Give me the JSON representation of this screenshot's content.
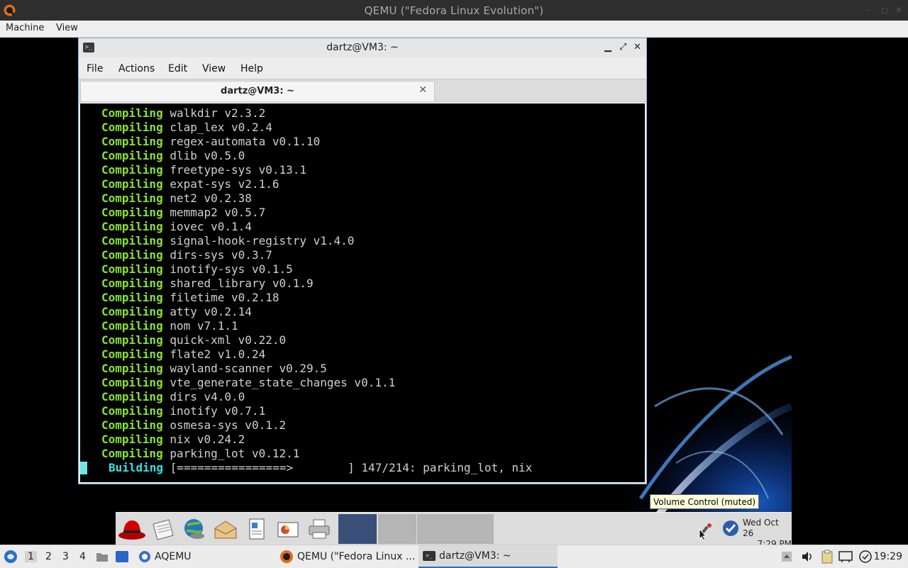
{
  "host": {
    "title": "QEMU (\"Fedora Linux Evolution\")",
    "menu": [
      "Machine",
      "View"
    ]
  },
  "terminal": {
    "window_title": "dartz@VM3: ~",
    "menu": [
      "File",
      "Actions",
      "Edit",
      "View",
      "Help"
    ],
    "tab_label": "dartz@VM3: ~",
    "lines": [
      {
        "kw": "Compiling",
        "text": "walkdir v2.3.2"
      },
      {
        "kw": "Compiling",
        "text": "clap_lex v0.2.4"
      },
      {
        "kw": "Compiling",
        "text": "regex-automata v0.1.10"
      },
      {
        "kw": "Compiling",
        "text": "dlib v0.5.0"
      },
      {
        "kw": "Compiling",
        "text": "freetype-sys v0.13.1"
      },
      {
        "kw": "Compiling",
        "text": "expat-sys v2.1.6"
      },
      {
        "kw": "Compiling",
        "text": "net2 v0.2.38"
      },
      {
        "kw": "Compiling",
        "text": "memmap2 v0.5.7"
      },
      {
        "kw": "Compiling",
        "text": "iovec v0.1.4"
      },
      {
        "kw": "Compiling",
        "text": "signal-hook-registry v1.4.0"
      },
      {
        "kw": "Compiling",
        "text": "dirs-sys v0.3.7"
      },
      {
        "kw": "Compiling",
        "text": "inotify-sys v0.1.5"
      },
      {
        "kw": "Compiling",
        "text": "shared_library v0.1.9"
      },
      {
        "kw": "Compiling",
        "text": "filetime v0.2.18"
      },
      {
        "kw": "Compiling",
        "text": "atty v0.2.14"
      },
      {
        "kw": "Compiling",
        "text": "nom v7.1.1"
      },
      {
        "kw": "Compiling",
        "text": "quick-xml v0.22.0"
      },
      {
        "kw": "Compiling",
        "text": "flate2 v1.0.24"
      },
      {
        "kw": "Compiling",
        "text": "wayland-scanner v0.29.5"
      },
      {
        "kw": "Compiling",
        "text": "vte_generate_state_changes v0.1.1"
      },
      {
        "kw": "Compiling",
        "text": "dirs v4.0.0"
      },
      {
        "kw": "Compiling",
        "text": "inotify v0.7.1"
      },
      {
        "kw": "Compiling",
        "text": "osmesa-sys v0.1.2"
      },
      {
        "kw": "Compiling",
        "text": "nix v0.24.2"
      },
      {
        "kw": "Compiling",
        "text": "parking_lot v0.12.1"
      }
    ],
    "building_kw": "Building",
    "building_text": "[================>        ] 147/214: parking_lot, nix"
  },
  "guest_panel": {
    "tooltip": "Volume Control (muted)",
    "clock_date": "Wed Oct 26",
    "clock_time": "7:29 PM"
  },
  "host_taskbar": {
    "workspaces": [
      "1",
      "2",
      "3",
      "4"
    ],
    "items": [
      {
        "label": "AQEMU"
      },
      {
        "label": "QEMU (\"Fedora Linux ..."
      },
      {
        "label": "dartz@VM3: ~"
      }
    ],
    "clock": "19:29"
  }
}
